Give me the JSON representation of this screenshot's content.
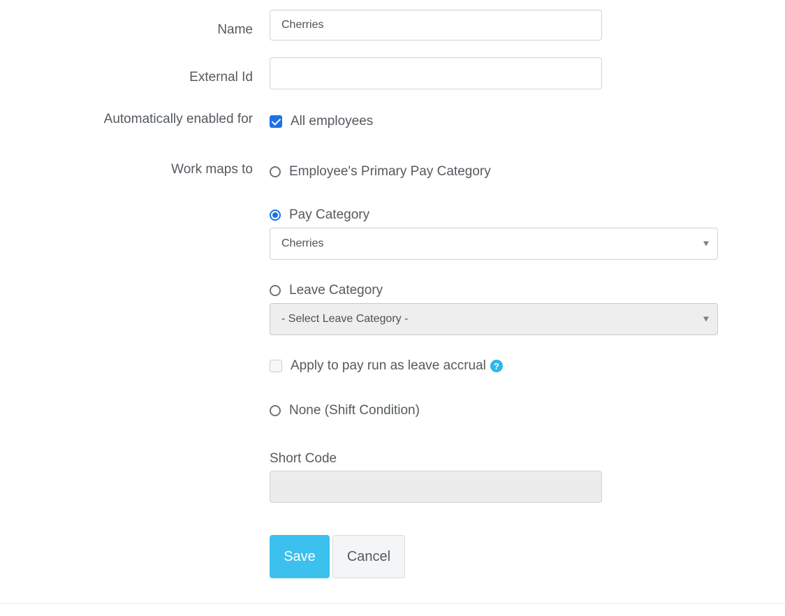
{
  "form": {
    "name": {
      "label": "Name",
      "value": "Cherries"
    },
    "external_id": {
      "label": "External Id",
      "value": ""
    },
    "auto_enabled": {
      "label": "Automatically enabled for",
      "option_label": "All employees",
      "checked": true
    },
    "work_maps_to": {
      "label": "Work maps to",
      "options": [
        {
          "label": "Employee's Primary Pay Category",
          "selected": false
        },
        {
          "label": "Pay Category",
          "selected": true
        },
        {
          "label": "Leave Category",
          "selected": false
        },
        {
          "label": "None (Shift Condition)",
          "selected": false
        }
      ],
      "pay_category_select": {
        "value": "Cherries"
      },
      "leave_category_select": {
        "value": "- Select Leave Category -",
        "disabled": true
      },
      "apply_leave_accrual": {
        "label": "Apply to pay run as leave accrual",
        "checked": false
      }
    },
    "short_code": {
      "label": "Short Code",
      "value": "",
      "disabled": true
    }
  },
  "actions": {
    "save_label": "Save",
    "cancel_label": "Cancel"
  },
  "colors": {
    "primary_button": "#3cc0ee",
    "accent_blue": "#1a73e8",
    "help_icon": "#2bb8e8"
  }
}
